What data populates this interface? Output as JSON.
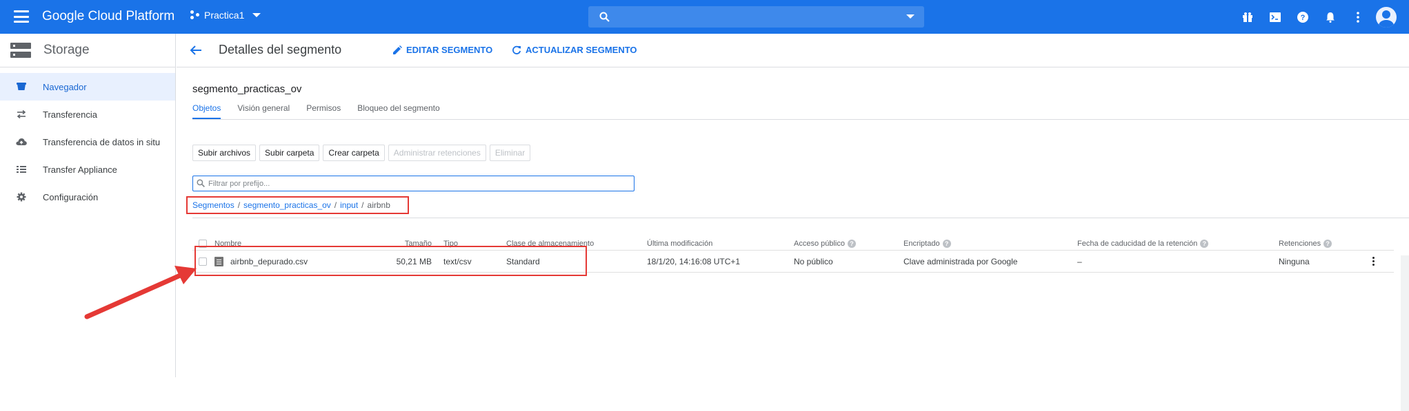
{
  "topbar": {
    "brand": "Google Cloud Platform",
    "project": "Practica1",
    "search_placeholder": "",
    "icons": [
      "gift-icon",
      "cloud-shell-icon",
      "help-icon",
      "notifications-icon",
      "more-vert-icon",
      "avatar"
    ]
  },
  "sidebar": {
    "title": "Storage",
    "items": [
      {
        "label": "Navegador",
        "icon": "bucket-icon",
        "active": true
      },
      {
        "label": "Transferencia",
        "icon": "transfer-icon",
        "active": false
      },
      {
        "label": "Transferencia de datos in situ",
        "icon": "cloud-upload-icon",
        "active": false
      },
      {
        "label": "Transfer Appliance",
        "icon": "list-icon",
        "active": false
      },
      {
        "label": "Configuración",
        "icon": "gear-icon",
        "active": false
      }
    ]
  },
  "header": {
    "title": "Detalles del segmento",
    "edit_label": "EDITAR SEGMENTO",
    "refresh_label": "ACTUALIZAR SEGMENTO"
  },
  "bucket": {
    "name": "segmento_practicas_ov",
    "tabs": [
      "Objetos",
      "Visión general",
      "Permisos",
      "Bloqueo del segmento"
    ]
  },
  "toolbar": {
    "upload_files": "Subir archivos",
    "upload_folder": "Subir carpeta",
    "create_folder": "Crear carpeta",
    "manage_holds": "Administrar retenciones",
    "delete": "Eliminar"
  },
  "filter": {
    "placeholder": "Filtrar por prefijo..."
  },
  "breadcrumb": {
    "root": "Segmentos",
    "bucket": "segmento_practicas_ov",
    "folder": "input",
    "current": "airbnb"
  },
  "table": {
    "columns": {
      "name": "Nombre",
      "size": "Tamaño",
      "type": "Tipo",
      "storage_class": "Clase de almacenamiento",
      "modified": "Última modificación",
      "public_access": "Acceso público",
      "encryption": "Encriptado",
      "retention_expiry": "Fecha de caducidad de la retención",
      "holds": "Retenciones"
    },
    "rows": [
      {
        "name": "airbnb_depurado.csv",
        "size": "50,21 MB",
        "type": "text/csv",
        "storage_class": "Standard",
        "modified": "18/1/20, 14:16:08 UTC+1",
        "public_access": "No público",
        "encryption": "Clave administrada por Google",
        "retention_expiry": "–",
        "holds": "Ninguna"
      }
    ]
  },
  "colors": {
    "topbar": "#1a73e8",
    "accent": "#1a73e8",
    "annotation": "#e53935"
  }
}
